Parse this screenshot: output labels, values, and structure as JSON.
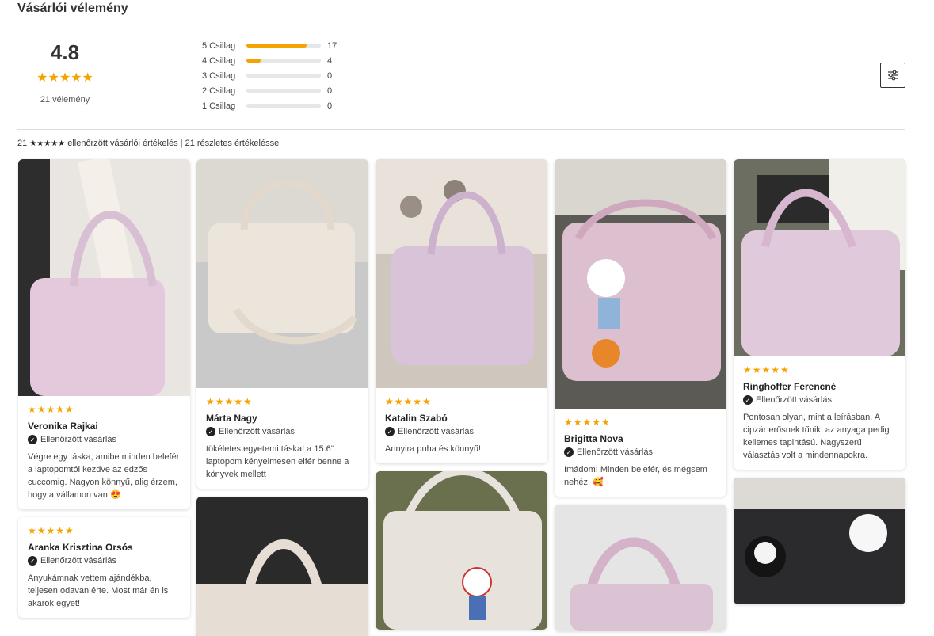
{
  "header": {
    "title": "Vásárlói vélemény"
  },
  "summary": {
    "average": "4.8",
    "stars": "★★★★★",
    "count_label": "21 vélemény",
    "distribution": [
      {
        "label": "5 Csillag",
        "count": "17",
        "fraction": 0.81
      },
      {
        "label": "4 Csillag",
        "count": "4",
        "fraction": 0.19
      },
      {
        "label": "3 Csillag",
        "count": "0",
        "fraction": 0
      },
      {
        "label": "2 Csillag",
        "count": "0",
        "fraction": 0
      },
      {
        "label": "1  Csillag",
        "count": "0",
        "fraction": 0
      }
    ]
  },
  "filter": {
    "icon": "sliders-icon"
  },
  "verified_summary": {
    "prefix": "21",
    "stars": "★★★★★",
    "text": "ellenőrzött vásárlói értékelés | 21 részletes értékeléssel"
  },
  "verified_label": "Ellenőrzött vásárlás",
  "reviews": [
    {
      "stars": "★★★★★",
      "name": "Veronika Rajkai",
      "text": "Végre egy táska, amibe minden belefér a laptopomtól kezdve az edzős cuccomig. Nagyon könnyű, alig érzem, hogy a vállamon van 😍",
      "photo_color": "#e4c9dd"
    },
    {
      "stars": "★★★★★",
      "name": "Márta Nagy",
      "text": "tökéletes egyetemi táska! a 15.6'' laptopom kényelmesen elfér benne a könyvek mellett",
      "photo_color": "#ece5dc"
    },
    {
      "stars": "★★★★★",
      "name": "Katalin Szabó",
      "text": "Annyira puha és könnyű!",
      "photo_color": "#d8c3d8"
    },
    {
      "stars": "★★★★★",
      "name": "Brigitta Nova",
      "text": "Imádom! Minden belefér, és mégsem nehéz. 🥰",
      "photo_color": "#dcc0cf"
    },
    {
      "stars": "★★★★★",
      "name": "Ringhoffer Ferencné",
      "text": "Pontosan olyan, mint a leírásban. A cipzár erősnek tűnik, az anyaga pedig kellemes tapintású. Nagyszerű választás volt a mindennapokra.",
      "photo_color": "#dfc9da"
    },
    {
      "stars": "★★★★★",
      "name": "Aranka Krisztina Orsós",
      "text": "Anyukámnak vettem ajándékba, teljesen odavan érte. Most már én is akarok egyet!",
      "photo_color": "#e4c9dd"
    }
  ]
}
